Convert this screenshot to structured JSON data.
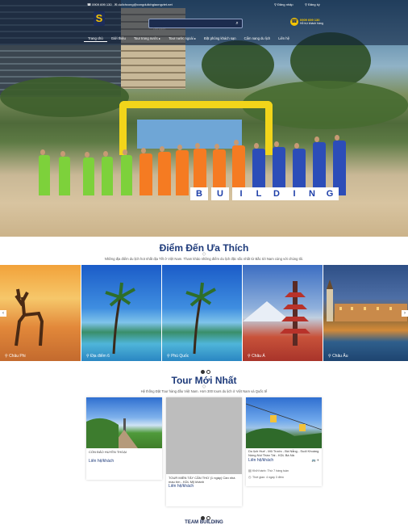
{
  "header": {
    "phone": "0909 699 130",
    "email": "dulichcong@congdulichgiaongviet.net",
    "login": "Đăng nhập",
    "register": "Đăng ký",
    "search_placeholder": "Tìm kiếm",
    "hotline_number": "0909 699 130",
    "hotline_label": "Hỗ trợ khách hàng",
    "nav": [
      "Trang chủ",
      "Giới thiệu",
      "Tour trong nước",
      "Tour nước ngoài",
      "Đặt phòng khách sạn",
      "Cẩm nang du lịch",
      "Liên hệ"
    ]
  },
  "hero": {
    "sign_letters": [
      "B",
      "U",
      "I",
      "L",
      "D",
      "I",
      "N",
      "G"
    ]
  },
  "destinations": {
    "title": "Điểm Đến Ưa Thích",
    "subtitle": "Những địa điểm du lịch hot nhất địa Tết ở Việt Nam. Tham khảo những điểm du lịch đặc sắc nhất từ Bắc tới Nam cùng với chúng tôi.",
    "items": [
      {
        "label": "Châu Phi"
      },
      {
        "label": "Địa điểm 6"
      },
      {
        "label": "Phú Quốc"
      },
      {
        "label": "Châu Á"
      },
      {
        "label": "Châu Âu"
      }
    ]
  },
  "tours": {
    "title": "Tour Mới Nhất",
    "subtitle": "Hệ thống Đặt Tour hàng đầu Việt Nam. Hơn 300 tours du lịch ở Việt Nam và Quốc tế",
    "items": [
      {
        "name": "CỔN ĐẢO HUYỀN THOẠI",
        "price": "Liên hệ/khách"
      },
      {
        "name": "TOUR MIỀN TÂY CẦN THƠ (1 ngày) Cần nhà mau tìm - KDL Mỹ khánh",
        "price": "Liên hệ/khách"
      },
      {
        "name": "Du lịch Huế - Mũ Trước - Bà Nẵng - Suối Khoáng Nóng Núi Thần Tài - KDL Bà Nà",
        "price": "Liên hệ/khách",
        "departure": "Khởi hành: Thứ 7 hàng tuần",
        "duration": "Thời gian: 4 ngày 3 đêm"
      }
    ]
  },
  "team": {
    "title": "TEAM BUILDING"
  }
}
